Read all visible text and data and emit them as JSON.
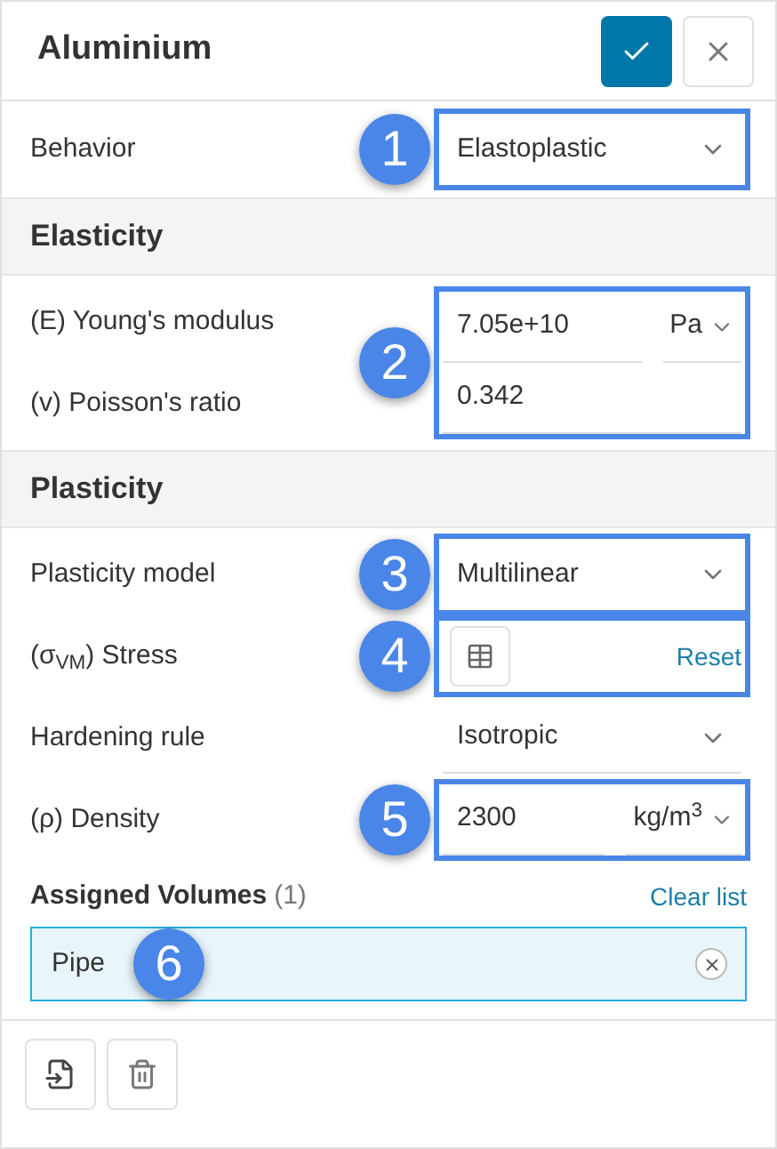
{
  "header": {
    "title": "Aluminium"
  },
  "behavior": {
    "callout": "1",
    "rows": [
      {
        "kind": "select",
        "label": "Behavior",
        "value": "Elastoplastic"
      }
    ]
  },
  "sections": [
    {
      "title": "Elasticity",
      "groups": [
        {
          "callout": "2",
          "rows": [
            {
              "kind": "number",
              "label": "(E) Young's modulus",
              "value": "7.05e+10",
              "unit": "Pa"
            },
            {
              "kind": "number",
              "label": "(v) Poisson's ratio",
              "value": "0.342"
            }
          ]
        }
      ]
    },
    {
      "title": "Plasticity",
      "groups": [
        {
          "callout": "3",
          "rows": [
            {
              "kind": "select",
              "label": "Plasticity model",
              "value": "Multilinear"
            }
          ]
        },
        {
          "callout": "4",
          "rows": [
            {
              "kind": "table",
              "label": "(σ$_{VM}$) Stress",
              "link": "Reset"
            }
          ]
        },
        {
          "rows": [
            {
              "kind": "select",
              "label": "Hardening rule",
              "value": "Isotropic"
            }
          ]
        },
        {
          "callout": "5",
          "rows": [
            {
              "kind": "number",
              "label": "(ρ) Density",
              "value": "2300",
              "unit": "kg/m$^{3}$"
            }
          ]
        }
      ]
    }
  ],
  "assigned": {
    "title": "Assigned Volumes",
    "count": "(1)",
    "clear": "Clear list",
    "items": [
      {
        "name": "Pipe",
        "callout": "6"
      }
    ]
  }
}
